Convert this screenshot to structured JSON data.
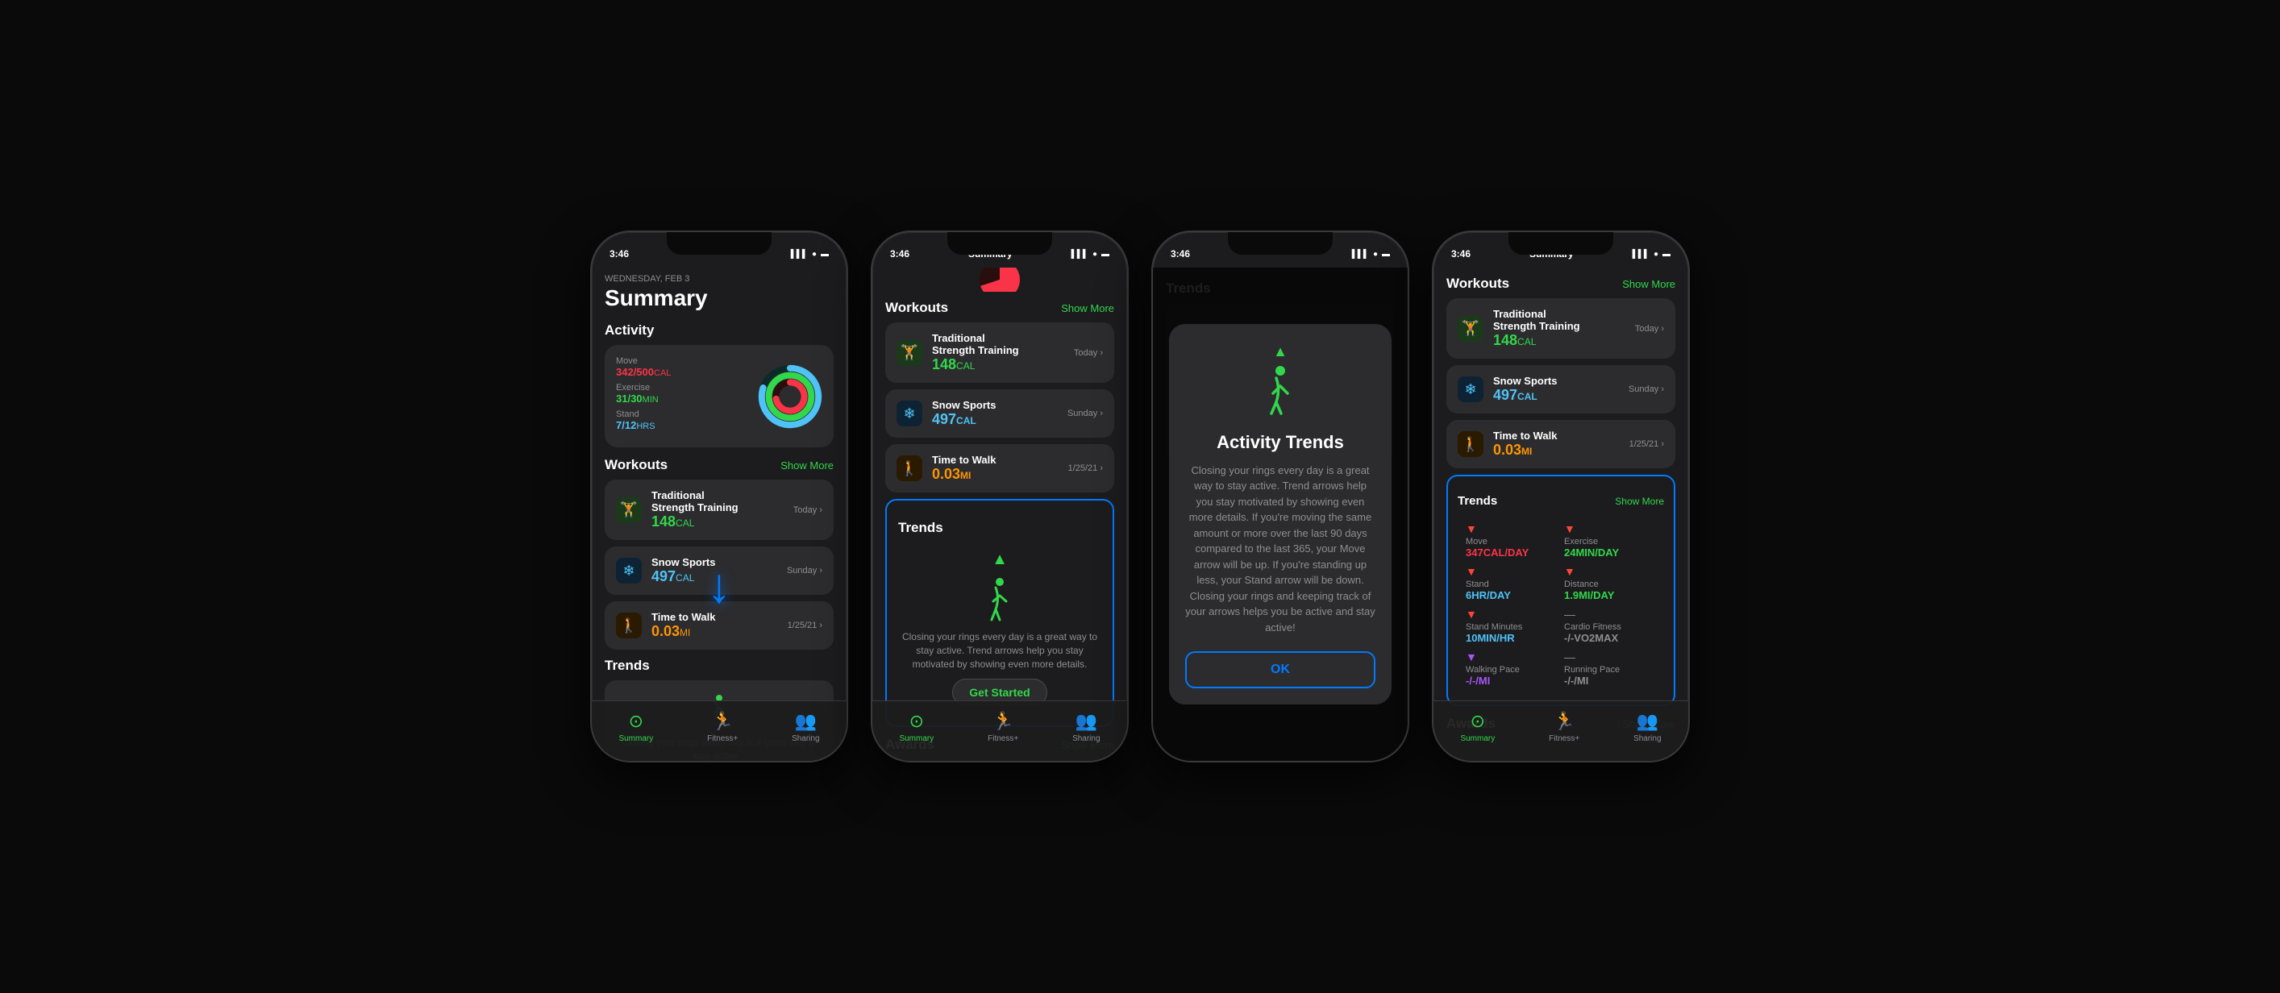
{
  "statusBar": {
    "time": "3:46",
    "signal": "▌▌▌",
    "wifi": "WiFi",
    "battery": "🔋"
  },
  "phone1": {
    "date": "WEDNESDAY, FEB 3",
    "title": "Summary",
    "activity": {
      "sectionTitle": "Activity",
      "move": {
        "label": "Move",
        "value": "342/500",
        "unit": "CAL"
      },
      "exercise": {
        "label": "Exercise",
        "value": "31/30",
        "unit": "MIN"
      },
      "stand": {
        "label": "Stand",
        "value": "7/12",
        "unit": "HRS"
      }
    },
    "workouts": {
      "sectionTitle": "Workouts",
      "showMore": "Show More",
      "items": [
        {
          "name": "Traditional\nStrength Training",
          "cal": "148",
          "unit": "CAL",
          "date": "Today",
          "type": "strength"
        },
        {
          "name": "Snow Sports",
          "cal": "497",
          "unit": "CAL",
          "date": "Sunday",
          "type": "snow"
        },
        {
          "name": "Time to Walk",
          "cal": "0.03",
          "unit": "MI",
          "date": "1/25/21",
          "type": "walk"
        }
      ]
    },
    "trends": {
      "sectionTitle": "Trends"
    }
  },
  "phone2": {
    "title": "Summary",
    "workouts": {
      "sectionTitle": "Workouts",
      "showMore": "Show More",
      "items": [
        {
          "name": "Traditional\nStrength Training",
          "cal": "148",
          "unit": "CAL",
          "date": "Today",
          "type": "strength"
        },
        {
          "name": "Snow Sports",
          "cal": "497",
          "unit": "CAL",
          "date": "Sunday",
          "type": "snow"
        },
        {
          "name": "Time to Walk",
          "cal": "0.03",
          "unit": "MI",
          "date": "1/25/21",
          "type": "walk"
        }
      ]
    },
    "trends": {
      "sectionTitle": "Trends",
      "description": "Closing your rings every day is a great way to stay active. Trend arrows help you stay motivated by showing even more details.",
      "getStarted": "Get Started"
    },
    "awards": {
      "sectionTitle": "Awards",
      "showMore": "Show More"
    }
  },
  "phone3": {
    "modal": {
      "title": "Activity Trends",
      "text": "Closing your rings every day is a great way to stay active. Trend arrows help you stay motivated by showing even more details. If you're moving the same amount or more over the last 90 days compared to the last 365, your Move arrow will be up. If you're standing up less, your Stand arrow will be down. Closing your rings and keeping track of your arrows helps you be active and stay active!",
      "okButton": "OK"
    }
  },
  "phone4": {
    "title": "Summary",
    "workouts": {
      "sectionTitle": "Workouts",
      "showMore": "Show More",
      "items": [
        {
          "name": "Traditional\nStrength Training",
          "cal": "148",
          "unit": "CAL",
          "date": "Today",
          "type": "strength"
        },
        {
          "name": "Snow Sports",
          "cal": "497",
          "unit": "CAL",
          "date": "Sunday",
          "type": "snow"
        },
        {
          "name": "Time to Walk",
          "cal": "0.03",
          "unit": "MI",
          "date": "1/25/21",
          "type": "walk"
        }
      ]
    },
    "trends": {
      "sectionTitle": "Trends",
      "showMore": "Show More",
      "items": [
        {
          "label": "Move",
          "value": "347CAL/DAY",
          "type": "move",
          "arrow": "down"
        },
        {
          "label": "Exercise",
          "value": "24MIN/DAY",
          "type": "exercise",
          "arrow": "down"
        },
        {
          "label": "Stand",
          "value": "6HR/DAY",
          "type": "stand",
          "arrow": "down"
        },
        {
          "label": "Distance",
          "value": "1.9MI/DAY",
          "type": "dist",
          "arrow": "down"
        },
        {
          "label": "Stand Minutes",
          "value": "10MIN/HR",
          "type": "standmin",
          "arrow": "down"
        },
        {
          "label": "Cardio Fitness",
          "value": "-/-VO2MAX",
          "type": "cardio",
          "arrow": "none"
        },
        {
          "label": "Walking Pace",
          "value": "-/-/MI",
          "type": "walk",
          "arrow": "none"
        },
        {
          "label": "Running Pace",
          "value": "-/-/MI",
          "type": "run",
          "arrow": "none"
        }
      ]
    },
    "awards": {
      "sectionTitle": "Awards",
      "showMore": "Show More"
    }
  },
  "nav": {
    "items": [
      "Summary",
      "Fitness+",
      "Sharing"
    ],
    "icons": [
      "⊙",
      "🏃",
      "👥"
    ]
  }
}
